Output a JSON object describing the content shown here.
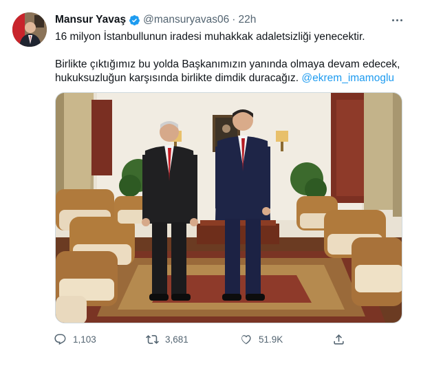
{
  "tweet": {
    "author_name": "Mansur Yavaş",
    "handle": "@mansuryavas06",
    "separator": "·",
    "time": "22h",
    "text_line1": "16 milyon İstanbullunun iradesi muhakkak adaletsizliği yenecektir.",
    "text_line2": "Birlikte çıktığımız bu yolda Başkanımızın yanında olmaya devam edecek,",
    "text_line3": "hukuksuzluğun karşısında birlikte dimdik duracağız.",
    "mention": "@ekrem_imamoglu"
  },
  "actions": {
    "reply_count": "1,103",
    "retweet_count": "3,681",
    "like_count": "51.9K"
  },
  "icons": {
    "verified": "verified-badge-icon",
    "more": "more-options-icon",
    "reply": "reply-icon",
    "retweet": "retweet-icon",
    "like": "heart-icon",
    "share": "share-icon"
  },
  "colors": {
    "accent": "#1d9bf0",
    "text_primary": "#0f1419",
    "text_secondary": "#536471"
  }
}
